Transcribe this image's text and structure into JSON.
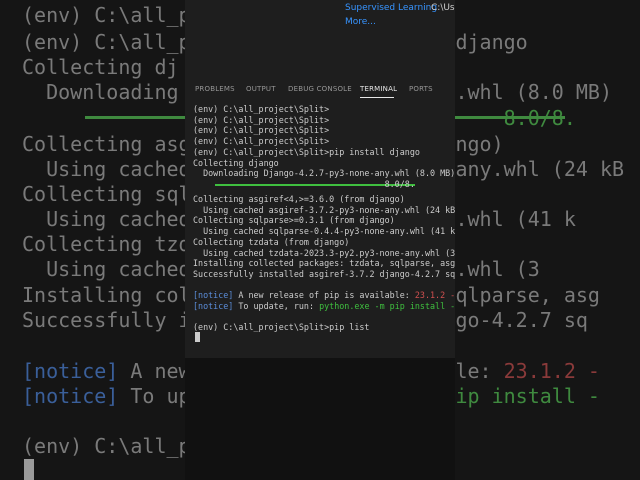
{
  "background_terminal": {
    "lines": [
      {
        "text": "(env) C:\\all_project\\Split>",
        "class": ""
      },
      {
        "text": "(env) C:\\all_p                  all django",
        "class": ""
      },
      {
        "text": "Collecting dj",
        "class": ""
      },
      {
        "text": "  Downloading                    any.whl (8.0 MB)",
        "class": ""
      },
      {
        "text": "                                        8.0/8.",
        "class": "green"
      },
      {
        "text": "Collecting asg                   django)",
        "class": ""
      },
      {
        "text": "  Using cached                   ne-any.whl (24 kB",
        "class": ""
      },
      {
        "text": "Collecting sql",
        "class": ""
      },
      {
        "text": "  Using cached                  -any.whl (41 k",
        "class": ""
      },
      {
        "text": "Collecting tzd",
        "class": ""
      },
      {
        "text": "  Using cached                  -any.whl (3",
        "class": ""
      },
      {
        "text": "Installing col                  a, sqlparse, asg",
        "class": ""
      },
      {
        "text": "Successfully i                  django-4.2.7 sq",
        "class": ""
      },
      {
        "text": "[notice] A new                  ilable: 23.1.2 -",
        "class": "mix1"
      },
      {
        "text": "[notice] To up                  -m pip install -",
        "class": "mix2"
      },
      {
        "text": "(env) C:\\all_p",
        "class": ""
      }
    ]
  },
  "panel": {
    "top_link_1": "Supervised Learning",
    "top_path_1": "C:\\Use",
    "top_link_2": "More...",
    "tabs": [
      {
        "label": "PROBLEMS",
        "active": false
      },
      {
        "label": "OUTPUT",
        "active": false
      },
      {
        "label": "DEBUG CONSOLE",
        "active": false
      },
      {
        "label": "TERMINAL",
        "active": true
      },
      {
        "label": "PORTS",
        "active": false
      }
    ],
    "terminal": {
      "l1": "(env) C:\\all_project\\Split>",
      "l2": "(env) C:\\all_project\\Split>",
      "l3": "(env) C:\\all_project\\Split>",
      "l4": "(env) C:\\all_project\\Split>",
      "l5": "(env) C:\\all_project\\Split>pip install django",
      "l6": "Collecting django",
      "l7": "  Downloading Django-4.2.7-py3-none-any.whl (8.0 MB)",
      "l8": "                                      8.0/8.",
      "l9": "Collecting asgiref<4,>=3.6.0 (from django)",
      "l10": "  Using cached asgiref-3.7.2-py3-none-any.whl (24 kB",
      "l11": "Collecting sqlparse>=0.3.1 (from django)",
      "l12": "  Using cached sqlparse-0.4.4-py3-none-any.whl (41 k",
      "l13": "Collecting tzdata (from django)",
      "l14": "  Using cached tzdata-2023.3-py2.py3-none-any.whl (3",
      "l15": "Installing collected packages: tzdata, sqlparse, asg",
      "l16": "Successfully installed asgiref-3.7.2 django-4.2.7 sq",
      "notice1_tag": "[notice]",
      "notice1_text": " A new release of pip is available: ",
      "notice1_ver": "23.1.2 -",
      "notice2_tag": "[notice]",
      "notice2_text": " To update, run: ",
      "notice2_cmd": "python.exe -m pip install -",
      "l19": "(env) C:\\all_project\\Split>pip list"
    }
  },
  "colors": {
    "notice": "#5b8dd9",
    "pip_version": "#d05050",
    "command": "#3fbf3f",
    "link": "#3794ff"
  }
}
